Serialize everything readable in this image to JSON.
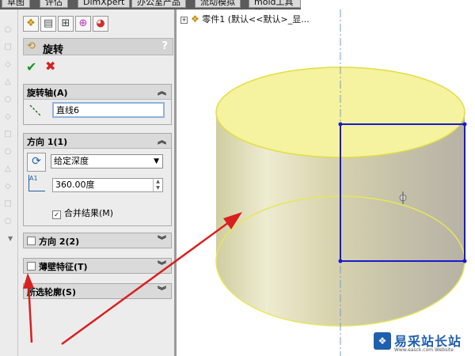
{
  "top_tabs": [
    "草图",
    "评估",
    "DimXpert",
    "办公室产品",
    "流动模拟",
    "mold工具箱"
  ],
  "feature": {
    "title": "旋转",
    "help": "?",
    "ok_symbol": "✔",
    "cancel_symbol": "✖"
  },
  "axis_group": {
    "title": "旋转轴(A)",
    "value": "直线6"
  },
  "dir1_group": {
    "title": "方向 1(1)",
    "type_value": "给定深度",
    "angle_value": "360.00度",
    "merge_label": "合并结果(M)",
    "merge_checked": true
  },
  "dir2_group": {
    "title": "方向 2(2)"
  },
  "thin_group": {
    "title": "薄壁特征(T)"
  },
  "contour_group": {
    "title": "所选轮廓(S)"
  },
  "tree": {
    "label": "零件1  (默认<<默认>_显..."
  },
  "watermark": {
    "main": "易采站长站",
    "sub": "Www.easck.com  Website"
  },
  "colors": {
    "sketch_blue": "#1a1acc",
    "body_yellow": "#f5f2a0",
    "arrow_red": "#d82020",
    "panel_bg": "#ececec"
  }
}
